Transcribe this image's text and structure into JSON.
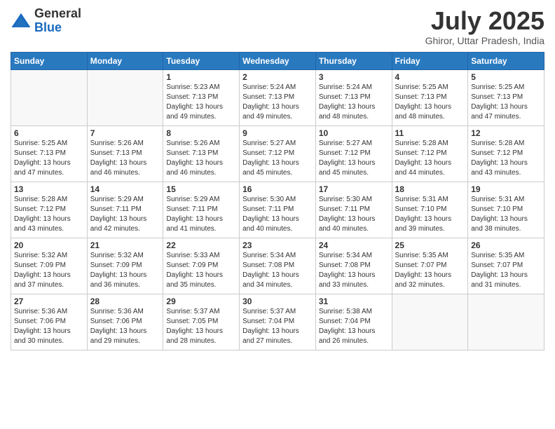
{
  "logo": {
    "general": "General",
    "blue": "Blue"
  },
  "title": {
    "month": "July 2025",
    "location": "Ghiror, Uttar Pradesh, India"
  },
  "days_of_week": [
    "Sunday",
    "Monday",
    "Tuesday",
    "Wednesday",
    "Thursday",
    "Friday",
    "Saturday"
  ],
  "weeks": [
    [
      {
        "day": "",
        "sunrise": "",
        "sunset": "",
        "daylight": ""
      },
      {
        "day": "",
        "sunrise": "",
        "sunset": "",
        "daylight": ""
      },
      {
        "day": "1",
        "sunrise": "Sunrise: 5:23 AM",
        "sunset": "Sunset: 7:13 PM",
        "daylight": "Daylight: 13 hours and 49 minutes."
      },
      {
        "day": "2",
        "sunrise": "Sunrise: 5:24 AM",
        "sunset": "Sunset: 7:13 PM",
        "daylight": "Daylight: 13 hours and 49 minutes."
      },
      {
        "day": "3",
        "sunrise": "Sunrise: 5:24 AM",
        "sunset": "Sunset: 7:13 PM",
        "daylight": "Daylight: 13 hours and 48 minutes."
      },
      {
        "day": "4",
        "sunrise": "Sunrise: 5:25 AM",
        "sunset": "Sunset: 7:13 PM",
        "daylight": "Daylight: 13 hours and 48 minutes."
      },
      {
        "day": "5",
        "sunrise": "Sunrise: 5:25 AM",
        "sunset": "Sunset: 7:13 PM",
        "daylight": "Daylight: 13 hours and 47 minutes."
      }
    ],
    [
      {
        "day": "6",
        "sunrise": "Sunrise: 5:25 AM",
        "sunset": "Sunset: 7:13 PM",
        "daylight": "Daylight: 13 hours and 47 minutes."
      },
      {
        "day": "7",
        "sunrise": "Sunrise: 5:26 AM",
        "sunset": "Sunset: 7:13 PM",
        "daylight": "Daylight: 13 hours and 46 minutes."
      },
      {
        "day": "8",
        "sunrise": "Sunrise: 5:26 AM",
        "sunset": "Sunset: 7:13 PM",
        "daylight": "Daylight: 13 hours and 46 minutes."
      },
      {
        "day": "9",
        "sunrise": "Sunrise: 5:27 AM",
        "sunset": "Sunset: 7:12 PM",
        "daylight": "Daylight: 13 hours and 45 minutes."
      },
      {
        "day": "10",
        "sunrise": "Sunrise: 5:27 AM",
        "sunset": "Sunset: 7:12 PM",
        "daylight": "Daylight: 13 hours and 45 minutes."
      },
      {
        "day": "11",
        "sunrise": "Sunrise: 5:28 AM",
        "sunset": "Sunset: 7:12 PM",
        "daylight": "Daylight: 13 hours and 44 minutes."
      },
      {
        "day": "12",
        "sunrise": "Sunrise: 5:28 AM",
        "sunset": "Sunset: 7:12 PM",
        "daylight": "Daylight: 13 hours and 43 minutes."
      }
    ],
    [
      {
        "day": "13",
        "sunrise": "Sunrise: 5:28 AM",
        "sunset": "Sunset: 7:12 PM",
        "daylight": "Daylight: 13 hours and 43 minutes."
      },
      {
        "day": "14",
        "sunrise": "Sunrise: 5:29 AM",
        "sunset": "Sunset: 7:11 PM",
        "daylight": "Daylight: 13 hours and 42 minutes."
      },
      {
        "day": "15",
        "sunrise": "Sunrise: 5:29 AM",
        "sunset": "Sunset: 7:11 PM",
        "daylight": "Daylight: 13 hours and 41 minutes."
      },
      {
        "day": "16",
        "sunrise": "Sunrise: 5:30 AM",
        "sunset": "Sunset: 7:11 PM",
        "daylight": "Daylight: 13 hours and 40 minutes."
      },
      {
        "day": "17",
        "sunrise": "Sunrise: 5:30 AM",
        "sunset": "Sunset: 7:11 PM",
        "daylight": "Daylight: 13 hours and 40 minutes."
      },
      {
        "day": "18",
        "sunrise": "Sunrise: 5:31 AM",
        "sunset": "Sunset: 7:10 PM",
        "daylight": "Daylight: 13 hours and 39 minutes."
      },
      {
        "day": "19",
        "sunrise": "Sunrise: 5:31 AM",
        "sunset": "Sunset: 7:10 PM",
        "daylight": "Daylight: 13 hours and 38 minutes."
      }
    ],
    [
      {
        "day": "20",
        "sunrise": "Sunrise: 5:32 AM",
        "sunset": "Sunset: 7:09 PM",
        "daylight": "Daylight: 13 hours and 37 minutes."
      },
      {
        "day": "21",
        "sunrise": "Sunrise: 5:32 AM",
        "sunset": "Sunset: 7:09 PM",
        "daylight": "Daylight: 13 hours and 36 minutes."
      },
      {
        "day": "22",
        "sunrise": "Sunrise: 5:33 AM",
        "sunset": "Sunset: 7:09 PM",
        "daylight": "Daylight: 13 hours and 35 minutes."
      },
      {
        "day": "23",
        "sunrise": "Sunrise: 5:34 AM",
        "sunset": "Sunset: 7:08 PM",
        "daylight": "Daylight: 13 hours and 34 minutes."
      },
      {
        "day": "24",
        "sunrise": "Sunrise: 5:34 AM",
        "sunset": "Sunset: 7:08 PM",
        "daylight": "Daylight: 13 hours and 33 minutes."
      },
      {
        "day": "25",
        "sunrise": "Sunrise: 5:35 AM",
        "sunset": "Sunset: 7:07 PM",
        "daylight": "Daylight: 13 hours and 32 minutes."
      },
      {
        "day": "26",
        "sunrise": "Sunrise: 5:35 AM",
        "sunset": "Sunset: 7:07 PM",
        "daylight": "Daylight: 13 hours and 31 minutes."
      }
    ],
    [
      {
        "day": "27",
        "sunrise": "Sunrise: 5:36 AM",
        "sunset": "Sunset: 7:06 PM",
        "daylight": "Daylight: 13 hours and 30 minutes."
      },
      {
        "day": "28",
        "sunrise": "Sunrise: 5:36 AM",
        "sunset": "Sunset: 7:06 PM",
        "daylight": "Daylight: 13 hours and 29 minutes."
      },
      {
        "day": "29",
        "sunrise": "Sunrise: 5:37 AM",
        "sunset": "Sunset: 7:05 PM",
        "daylight": "Daylight: 13 hours and 28 minutes."
      },
      {
        "day": "30",
        "sunrise": "Sunrise: 5:37 AM",
        "sunset": "Sunset: 7:04 PM",
        "daylight": "Daylight: 13 hours and 27 minutes."
      },
      {
        "day": "31",
        "sunrise": "Sunrise: 5:38 AM",
        "sunset": "Sunset: 7:04 PM",
        "daylight": "Daylight: 13 hours and 26 minutes."
      },
      {
        "day": "",
        "sunrise": "",
        "sunset": "",
        "daylight": ""
      },
      {
        "day": "",
        "sunrise": "",
        "sunset": "",
        "daylight": ""
      }
    ]
  ]
}
